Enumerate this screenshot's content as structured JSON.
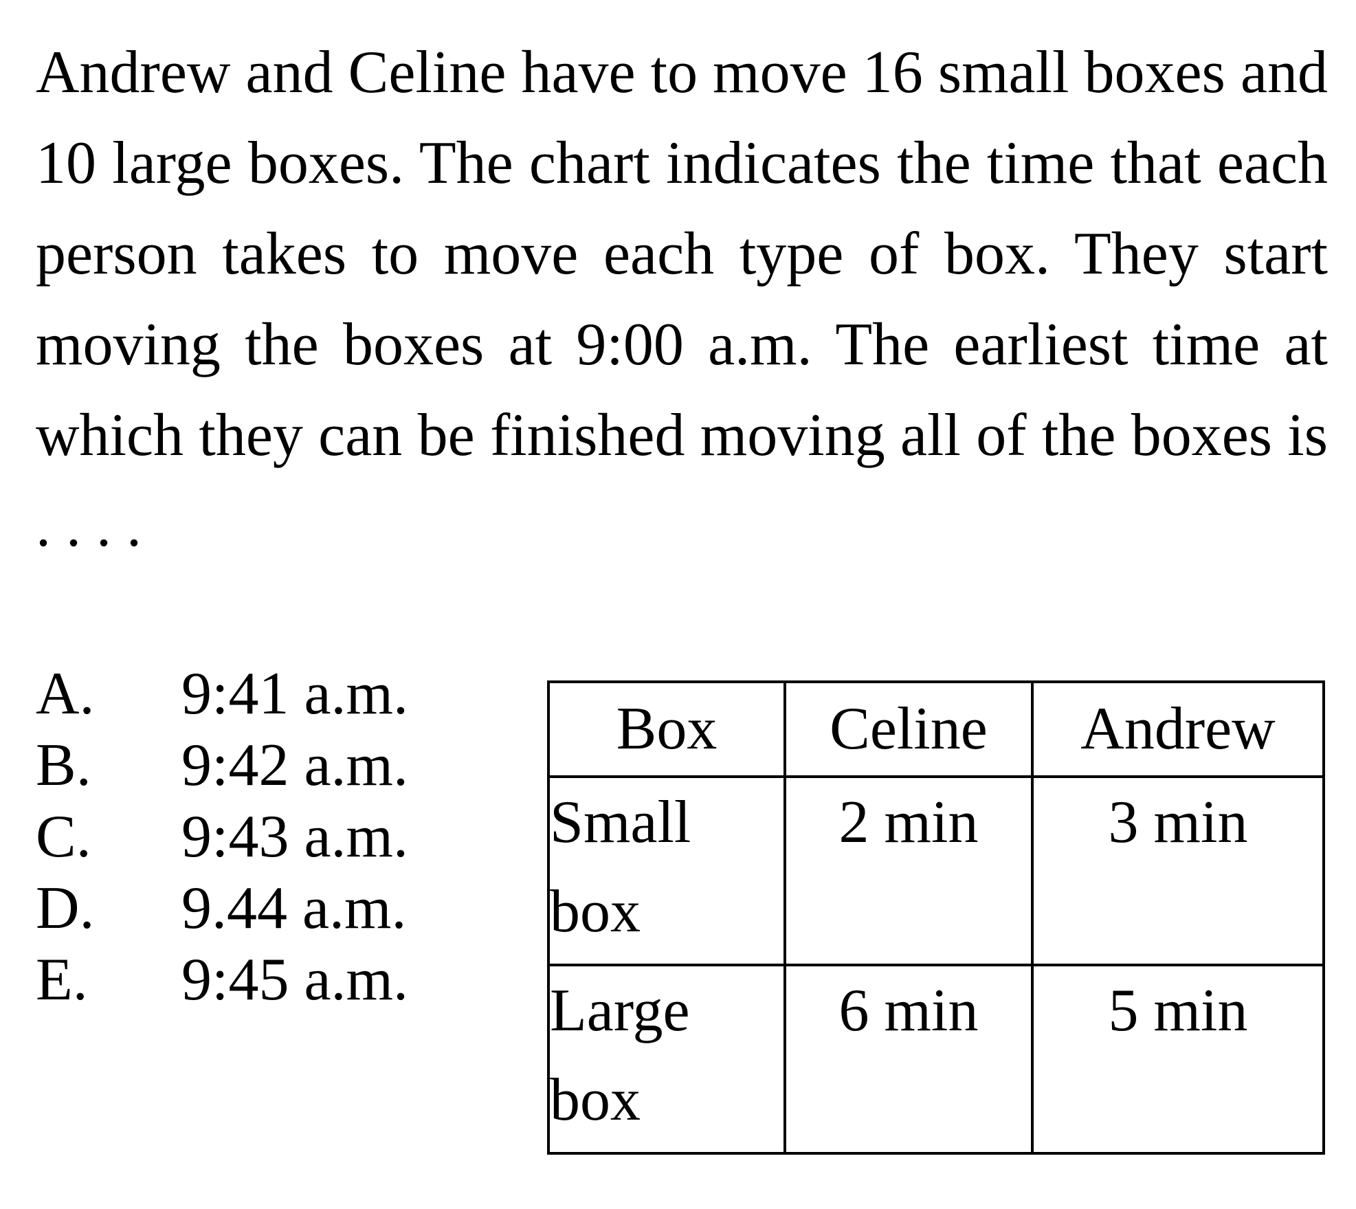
{
  "question": {
    "text": "Andrew and Celine have to move 16 small boxes and 10 large boxes. The chart indicates the time that each person takes to move each type of box. They start moving the boxes at 9:00 a.m. The earliest time at which they can be finished moving all of the boxes is . . . ."
  },
  "options": [
    {
      "letter": "A.",
      "text": "9:41 a.m."
    },
    {
      "letter": "B.",
      "text": "9:42 a.m."
    },
    {
      "letter": "C.",
      "text": "9:43 a.m."
    },
    {
      "letter": "D.",
      "text": "9.44 a.m."
    },
    {
      "letter": "E.",
      "text": "9:45 a.m."
    }
  ],
  "table": {
    "headers": [
      "Box",
      "Celine",
      "Andrew"
    ],
    "rows": [
      {
        "label_line1": "Small",
        "label_line2": "box",
        "celine": "2 min",
        "andrew": "3 min"
      },
      {
        "label_line1": "Large",
        "label_line2": "box",
        "celine": "6 min",
        "andrew": "5 min"
      }
    ]
  }
}
